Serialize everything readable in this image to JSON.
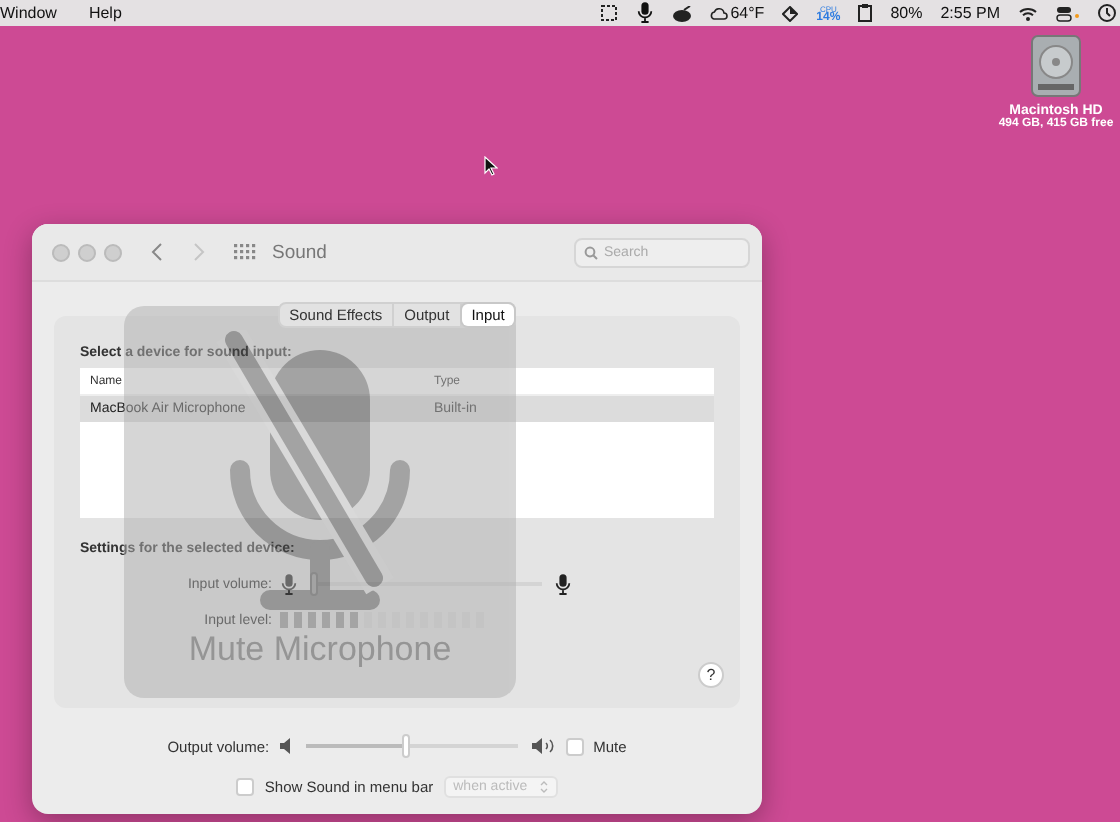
{
  "menu_bar": {
    "menus": [
      "Window",
      "Help"
    ],
    "weather": "64°F",
    "cpu_label": "CPU",
    "cpu_value": "14%",
    "battery": "80%",
    "clock": "2:55 PM"
  },
  "desktop_icon": {
    "name": "Macintosh HD",
    "detail": "494 GB, 415 GB free"
  },
  "window": {
    "title": "Sound",
    "search": {
      "placeholder": "Search"
    },
    "tabs": [
      {
        "label": "Sound Effects",
        "selected": false
      },
      {
        "label": "Output",
        "selected": false
      },
      {
        "label": "Input",
        "selected": true
      }
    ],
    "device_heading": "Select a device for sound input:",
    "table": {
      "columns": [
        "Name",
        "Type"
      ],
      "rows": [
        {
          "name": "MacBook Air Microphone",
          "type": "Built-in",
          "selected": true
        }
      ]
    },
    "settings_heading": "Settings for the selected device:",
    "input_volume": {
      "label": "Input volume:",
      "level": 0.03
    },
    "input_level": {
      "label": "Input level:",
      "level": 0.4
    },
    "help": "?",
    "output_volume": {
      "label": "Output volume:",
      "level": 0.48
    },
    "mute": {
      "label": "Mute",
      "checked": false
    },
    "show_in_menu_bar": {
      "label": "Show Sound in menu bar",
      "checked": false
    },
    "menu_bar_option": {
      "value": "when active",
      "disabled": true
    }
  },
  "hud": {
    "label": "Mute Microphone"
  }
}
